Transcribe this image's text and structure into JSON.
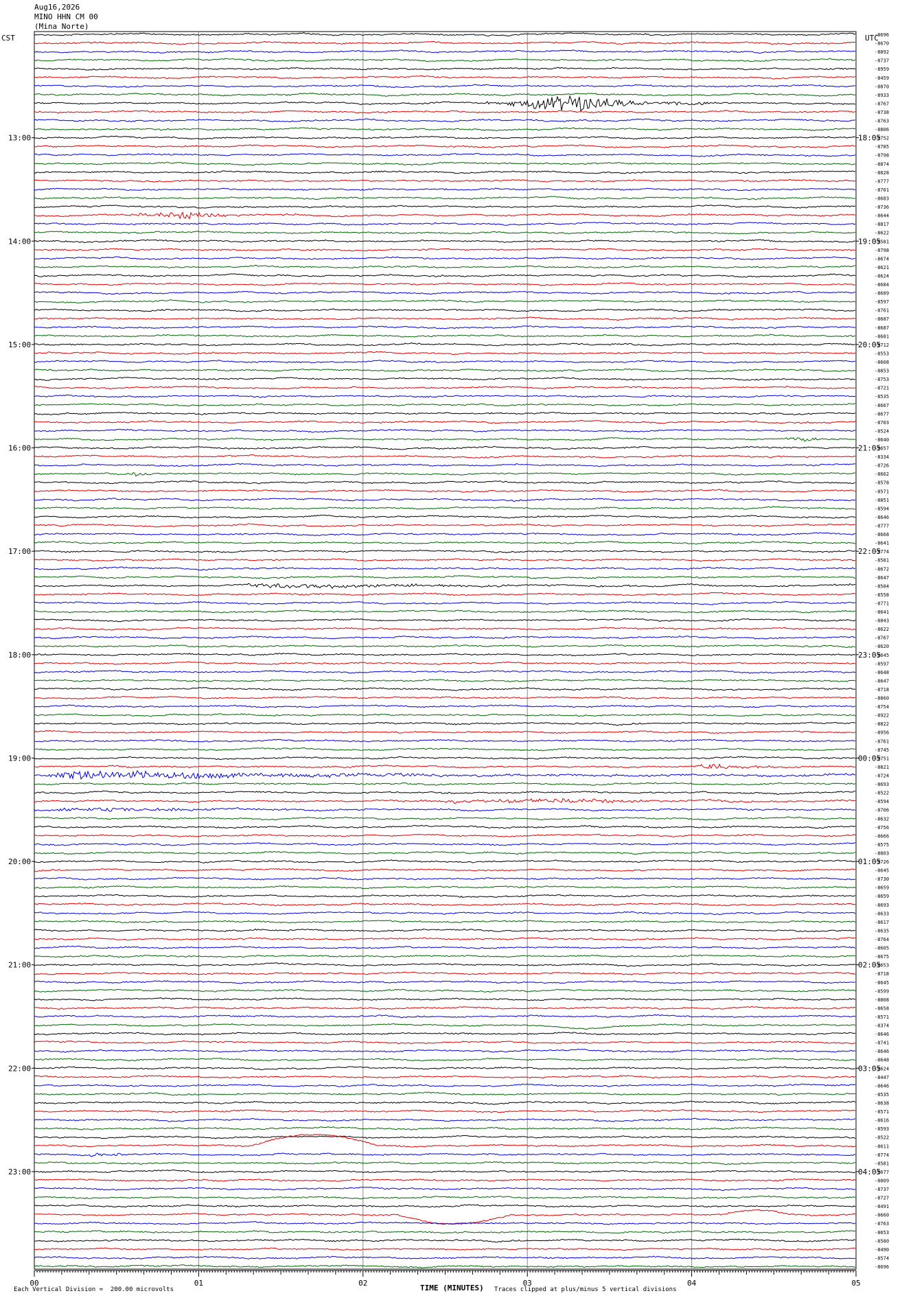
{
  "header": {
    "date": "Aug16,2026",
    "station": "MINO HHN CM 00",
    "location": "(Mina Norte)",
    "left_zone": "CST",
    "right_zone": "UTC"
  },
  "footer": {
    "scale_note": "Each Vertical Division =  200.00 microvolts",
    "clip_note": "Traces clipped at plus/minus 5 vertical divisions",
    "x_axis_title": "TIME (MINUTES)"
  },
  "chart_data": {
    "type": "line",
    "title": "",
    "xlabel": "TIME (MINUTES)",
    "ylabel": "",
    "xlim": [
      0,
      5
    ],
    "x_ticks": [
      "00",
      "01",
      "02",
      "03",
      "04",
      "05"
    ],
    "grid": true,
    "trace_count": 144,
    "trace_colors": [
      "#000000",
      "#e00000",
      "#0000e0",
      "#006400"
    ],
    "left_time_labels": [
      {
        "trace": 12,
        "label": "13:00"
      },
      {
        "trace": 24,
        "label": "14:00"
      },
      {
        "trace": 36,
        "label": "15:00"
      },
      {
        "trace": 48,
        "label": "16:00"
      },
      {
        "trace": 60,
        "label": "17:00"
      },
      {
        "trace": 72,
        "label": "18:00"
      },
      {
        "trace": 84,
        "label": "19:00"
      },
      {
        "trace": 96,
        "label": "20:00"
      },
      {
        "trace": 108,
        "label": "21:00"
      },
      {
        "trace": 120,
        "label": "22:00"
      },
      {
        "trace": 132,
        "label": "23:00"
      }
    ],
    "right_time_labels": [
      {
        "trace": 12,
        "label": "18:05"
      },
      {
        "trace": 24,
        "label": "19:05"
      },
      {
        "trace": 36,
        "label": "20:05"
      },
      {
        "trace": 48,
        "label": "21:05"
      },
      {
        "trace": 60,
        "label": "22:05"
      },
      {
        "trace": 72,
        "label": "23:05"
      },
      {
        "trace": 84,
        "label": "00:05"
      },
      {
        "trace": 96,
        "label": "01:05"
      },
      {
        "trace": 108,
        "label": "02:05"
      },
      {
        "trace": 120,
        "label": "03:05"
      },
      {
        "trace": 132,
        "label": "04:05"
      }
    ],
    "trace_mean_labels": [
      "-8696",
      "-8670",
      "-8892",
      "-8737",
      "-8959",
      "-8459",
      "-8870",
      "-8933",
      "-8767",
      "-8738",
      "-8763",
      "-8806",
      "-8752",
      "-8785",
      "-8798",
      "-8874",
      "-8828",
      "-8777",
      "-8701",
      "-8683",
      "-8736",
      "-8644",
      "-8817",
      "-8622",
      "-8581",
      "-8798",
      "-8674",
      "-8621",
      "-8624",
      "-8684",
      "-8689",
      "-8597",
      "-8761",
      "-8687",
      "-8687",
      "-8681",
      "-8712",
      "-8553",
      "-8608",
      "-8853",
      "-8753",
      "-8721",
      "-8535",
      "-8667",
      "-8677",
      "-8703",
      "-8524",
      "-8640",
      "-8657",
      "-8334",
      "-8726",
      "-8662",
      "-8578",
      "-8571",
      "-8851",
      "-8594",
      "-8646",
      "-8777",
      "-8668",
      "-8641",
      "-8774",
      "-8581",
      "-8672",
      "-8647",
      "-8584",
      "-8558",
      "-8771",
      "-8641",
      "-8843",
      "-8622",
      "-8767",
      "-8620",
      "-8645",
      "-8597",
      "-8648",
      "-8647",
      "-8718",
      "-8860",
      "-8754",
      "-8922",
      "-8822",
      "-8956",
      "-8761",
      "-8745",
      "-8751",
      "-8821",
      "-8724",
      "-8693",
      "-8522",
      "-8594",
      "-8706",
      "-8632",
      "-8756",
      "-8666",
      "-8575",
      "-8803",
      "-8726",
      "-8645",
      "-8730",
      "-8659",
      "-8659",
      "-8693",
      "-8633",
      "-8617",
      "-8635",
      "-8764",
      "-8605",
      "-8675",
      "-8653",
      "-8718",
      "-8645",
      "-8599",
      "-8808",
      "-8658",
      "-8571",
      "-8374",
      "-8646",
      "-8741",
      "-8646",
      "-8648",
      "-8624",
      "-8447",
      "-8646",
      "-8535",
      "-8638",
      "-8571",
      "-8616",
      "-8593",
      "-8522",
      "-8611",
      "-8774",
      "-8581",
      "-8677",
      "-8809",
      "-8737",
      "-8727",
      "-8491",
      "-8660",
      "-8763",
      "-8653",
      "-8580",
      "-8490",
      "-8574",
      "-8696"
    ],
    "events": [
      {
        "trace": 8,
        "start_min": 2.75,
        "peak_min": 3.3,
        "end_min": 4.1,
        "amp": 12
      },
      {
        "trace": 21,
        "start_min": 0.5,
        "peak_min": 0.95,
        "end_min": 1.6,
        "amp": 5
      },
      {
        "trace": 47,
        "start_min": 4.5,
        "peak_min": 4.65,
        "end_min": 5.0,
        "amp": 3
      },
      {
        "trace": 51,
        "start_min": 0.55,
        "peak_min": 0.62,
        "end_min": 0.75,
        "amp": 4
      },
      {
        "trace": 64,
        "start_min": 1.25,
        "peak_min": 1.38,
        "end_min": 5.0,
        "amp": 3
      },
      {
        "trace": 85,
        "start_min": 4.0,
        "peak_min": 4.1,
        "end_min": 5.0,
        "amp": 4
      },
      {
        "trace": 86,
        "start_min": 0.0,
        "peak_min": 0.25,
        "end_min": 5.0,
        "amp": 6
      },
      {
        "trace": 89,
        "start_min": 2.0,
        "peak_min": 3.25,
        "end_min": 5.0,
        "amp": 3
      },
      {
        "trace": 90,
        "start_min": 0.0,
        "peak_min": 0.3,
        "end_min": 2.5,
        "amp": 3
      },
      {
        "trace": 130,
        "start_min": 0.3,
        "peak_min": 0.38,
        "end_min": 0.8,
        "amp": 3
      }
    ],
    "long_period_waves": [
      {
        "trace": 129,
        "start_min": 1.3,
        "end_min": 2.1,
        "amp": 16
      },
      {
        "trace": 137,
        "start_min": 2.2,
        "end_min": 2.9,
        "amp": -14
      },
      {
        "trace": 137,
        "start_min": 4.2,
        "end_min": 4.6,
        "amp": 6
      },
      {
        "trace": 115,
        "start_min": 3.0,
        "end_min": 3.6,
        "amp": -5
      }
    ]
  }
}
